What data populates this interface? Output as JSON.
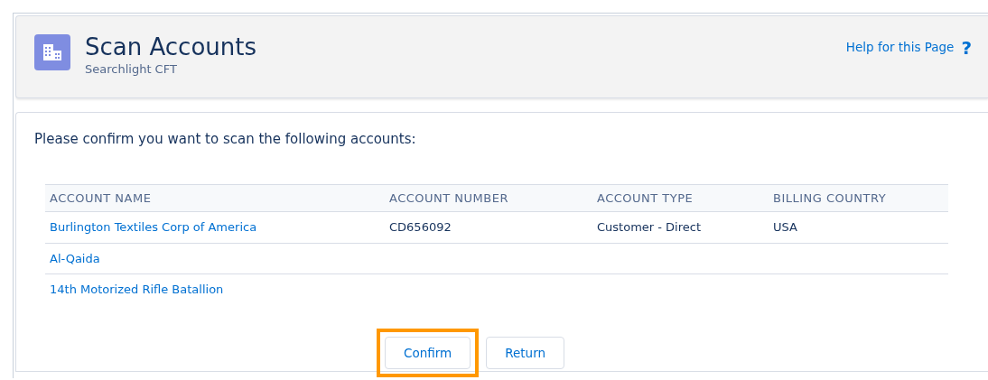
{
  "header": {
    "title": "Scan Accounts",
    "subtitle": "Searchlight CFT",
    "help_link": "Help for this Page",
    "help_icon": "?"
  },
  "prompt": "Please confirm you want to scan the following accounts:",
  "table": {
    "columns": [
      "ACCOUNT NAME",
      "ACCOUNT NUMBER",
      "ACCOUNT TYPE",
      "BILLING COUNTRY"
    ],
    "rows": [
      {
        "name": "Burlington Textiles Corp of America",
        "number": "CD656092",
        "type": "Customer - Direct",
        "country": "USA"
      },
      {
        "name": "Al-Qaida"
      },
      {
        "name": "14th Motorized Rifle Batallion"
      }
    ]
  },
  "buttons": [
    {
      "label": "Confirm",
      "highlighted": true
    },
    {
      "label": "Return",
      "highlighted": false
    }
  ]
}
